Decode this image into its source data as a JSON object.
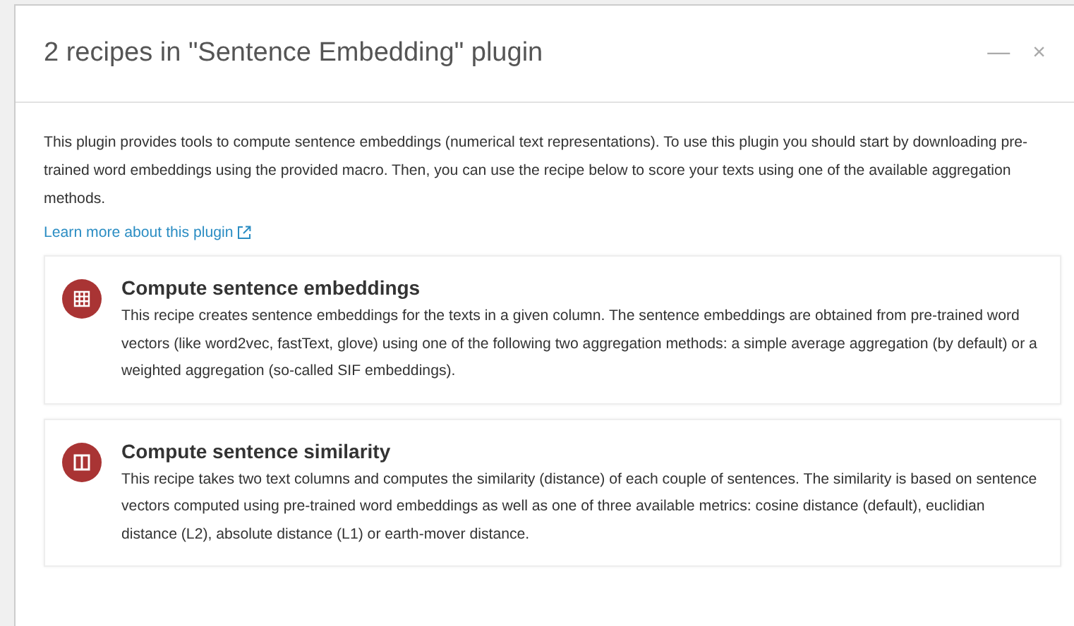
{
  "dialog": {
    "title": "2 recipes in \"Sentence Embedding\" plugin",
    "minimize": "—",
    "close": "×"
  },
  "description": "This plugin provides tools to compute sentence embeddings (numerical text representations). To use this plugin you should start by downloading pre-trained word embeddings using the provided macro. Then, you can use the recipe below to score your texts using one of the available aggregation methods.",
  "learn_more": "Learn more about this plugin",
  "recipes": [
    {
      "kind": "table",
      "title": "Compute sentence embeddings",
      "description": "This recipe creates sentence embeddings for the texts in a given column. The sentence embeddings are obtained from pre-trained word vectors (like word2vec, fastText, glove) using one of the following two aggregation methods: a simple average aggregation (by default) or a weighted aggregation (so-called SIF embeddings)."
    },
    {
      "kind": "split",
      "title": "Compute sentence similarity",
      "description": "This recipe takes two text columns and computes the similarity (distance) of each couple of sentences. The similarity is based on sentence vectors computed using pre-trained word embeddings as well as one of three available metrics: cosine distance (default), euclidian distance (L2), absolute distance (L1) or earth-mover distance."
    }
  ]
}
